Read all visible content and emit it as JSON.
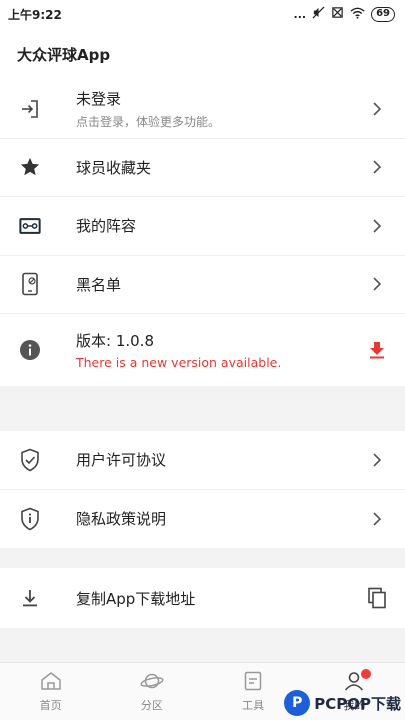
{
  "status_bar": {
    "time": "上午9:22",
    "dots": "...",
    "battery": "69"
  },
  "header": {
    "title": "大众评球App"
  },
  "menu": {
    "login": {
      "title": "未登录",
      "subtitle": "点击登录，体验更多功能。"
    },
    "favorites": {
      "title": "球员收藏夹"
    },
    "lineup": {
      "title": "我的阵容"
    },
    "blacklist": {
      "title": "黑名单"
    },
    "version": {
      "title": "版本: 1.0.8",
      "notice": "There is a new version available."
    },
    "license": {
      "title": "用户许可协议"
    },
    "privacy": {
      "title": "隐私政策说明"
    },
    "copy_link": {
      "title": "复制App下载地址"
    }
  },
  "tabs": [
    {
      "label": "首页",
      "icon": "home-icon"
    },
    {
      "label": "分区",
      "icon": "planet-icon"
    },
    {
      "label": "工具",
      "icon": "tools-icon"
    },
    {
      "label": "我的",
      "icon": "user-icon"
    }
  ],
  "watermark": {
    "text": "PCPOP下载"
  },
  "colors": {
    "accent_red": "#e53935",
    "text": "#222222",
    "muted": "#888888",
    "background": "#f3f3f3"
  }
}
